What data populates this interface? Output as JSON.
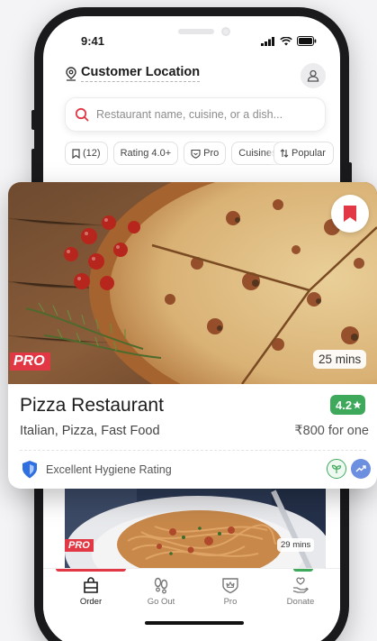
{
  "status": {
    "time": "9:41"
  },
  "header": {
    "location_label": "Customer Location"
  },
  "search": {
    "placeholder": "Restaurant name, cuisine, or a dish..."
  },
  "filters": [
    {
      "label": "(12)",
      "icon": "bookmark-icon"
    },
    {
      "label": "Rating 4.0+"
    },
    {
      "label": "Pro",
      "icon": "pro-shield-icon"
    },
    {
      "label": "Cuisines"
    }
  ],
  "sort": {
    "label": "Popular",
    "icon": "sort-icon"
  },
  "featured": {
    "name": "Pizza Restaurant",
    "rating": "4.2",
    "cuisines": "Italian, Pizza, Fast Food",
    "price": "₹800 for one",
    "delivery_time": "25 mins",
    "badge": "PRO",
    "hygiene": "Excellent Hygiene Rating"
  },
  "next_card": {
    "badge": "PRO",
    "delivery_time": "29 mins"
  },
  "tabs": [
    {
      "label": "Order",
      "icon": "bag-icon",
      "active": true
    },
    {
      "label": "Go Out",
      "icon": "footprints-icon"
    },
    {
      "label": "Pro",
      "icon": "pro-crown-icon"
    },
    {
      "label": "Donate",
      "icon": "donate-hand-icon"
    }
  ],
  "colors": {
    "brand_red": "#e23744",
    "rating_green": "#3fa95b"
  }
}
